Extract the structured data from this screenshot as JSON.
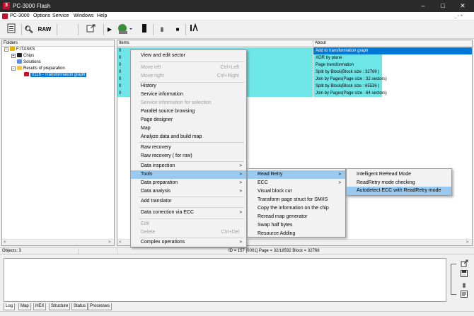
{
  "window": {
    "title": "PC-3000 Flash",
    "app_icon_glyph": "3",
    "controls": [
      "–",
      "□",
      "✕"
    ]
  },
  "menubar": {
    "app_label": "PC-3000",
    "items": [
      "Options",
      "Service",
      "Windows",
      "Help"
    ],
    "mdi_controls": "_ ▫ ×"
  },
  "toolbar": {
    "raw_label": "RAW"
  },
  "left_panel": {
    "header": "Folders",
    "tree": [
      {
        "label": "F:\\TASKS",
        "level": 0,
        "icon": "folder-icon"
      },
      {
        "label": "Chips",
        "level": 1,
        "icon": "chip-icon"
      },
      {
        "label": "Solutions",
        "level": 1,
        "icon": "solutions-icon"
      },
      {
        "label": "Results of preparation",
        "level": 1,
        "icon": "folder-open-icon"
      },
      {
        "label": "0116 - Transformation graph",
        "level": 2,
        "icon": "graph-icon",
        "selected": true
      }
    ]
  },
  "right_panel": {
    "col_items": "Items",
    "col_about": "About",
    "rows": [
      {
        "item": "0",
        "about": "Add to transformation graph",
        "selected": true
      },
      {
        "item": "0",
        "about": "XOR by plane"
      },
      {
        "item": "0",
        "about": "Page transformation"
      },
      {
        "item": "0",
        "about": "Split by Block(Block size : 32768  )"
      },
      {
        "item": "0",
        "about": "Join by Pages(Page size : 32 sectors)"
      },
      {
        "item": "0",
        "about": "Split by Block(Block size : 65536  )"
      },
      {
        "item": "0",
        "about": "Join by Pages(Page size : 64 sectors)"
      }
    ]
  },
  "statusbar": {
    "objects": "Objects: 3",
    "info": "ID = 157 [0001]  Page   = 32/18592  Block = 32768"
  },
  "tabs": [
    "Log",
    "Map",
    "HEX",
    "Structure",
    "Status",
    "Processes"
  ],
  "menu1": {
    "items": [
      {
        "label": "View and edit sector"
      },
      {
        "sep": true
      },
      {
        "label": "Move left",
        "shortcut": "Ctrl+Left",
        "disabled": true
      },
      {
        "label": "Move right",
        "shortcut": "Ctrl+Right",
        "disabled": true
      },
      {
        "sep": true
      },
      {
        "label": "History"
      },
      {
        "label": "Service information"
      },
      {
        "label": "Service information for selection",
        "disabled": true
      },
      {
        "label": "Parallel source browsing"
      },
      {
        "label": "Page designer"
      },
      {
        "label": "Map"
      },
      {
        "label": "Analyze data and build map"
      },
      {
        "sep": true
      },
      {
        "label": "Raw recovery"
      },
      {
        "label": "Raw recovery ( for row)"
      },
      {
        "sep": true
      },
      {
        "label": "Data inspection",
        "arrow": true
      },
      {
        "label": "Tools",
        "arrow": true,
        "highlight": true
      },
      {
        "label": "Data preparation",
        "arrow": true
      },
      {
        "label": "Data analysis",
        "arrow": true
      },
      {
        "sep": true
      },
      {
        "label": "Add translator"
      },
      {
        "sep": true
      },
      {
        "label": "Data correction via ECC",
        "arrow": true
      },
      {
        "sep": true
      },
      {
        "label": "Edit",
        "disabled": true
      },
      {
        "label": "Delete",
        "shortcut": "Ctrl+Del",
        "disabled": true
      },
      {
        "sep": true
      },
      {
        "label": "Complex operations",
        "arrow": true
      }
    ]
  },
  "menu2": {
    "items": [
      {
        "label": "Read Retry",
        "arrow": true,
        "highlight": true
      },
      {
        "label": "ECC",
        "arrow": true
      },
      {
        "label": "Visual block cut"
      },
      {
        "label": "Transform page struct for SM/IS"
      },
      {
        "label": "Copy the information on the chip"
      },
      {
        "label": "Reread map generator"
      },
      {
        "label": "Swap half bytes"
      },
      {
        "label": "Resource Adding"
      }
    ]
  },
  "menu3": {
    "items": [
      {
        "label": "Intelligent ReRead Mode"
      },
      {
        "label": "ReadRetry mode checking"
      },
      {
        "label": "Autodetect ECC with ReadRetry mode",
        "highlight": true
      }
    ]
  },
  "colors": {
    "selection": "#0078d7",
    "cyan_rows": "#6ee6e8",
    "menu_highlight": "#99c9ef",
    "titlebar": "#2b2b2b"
  }
}
